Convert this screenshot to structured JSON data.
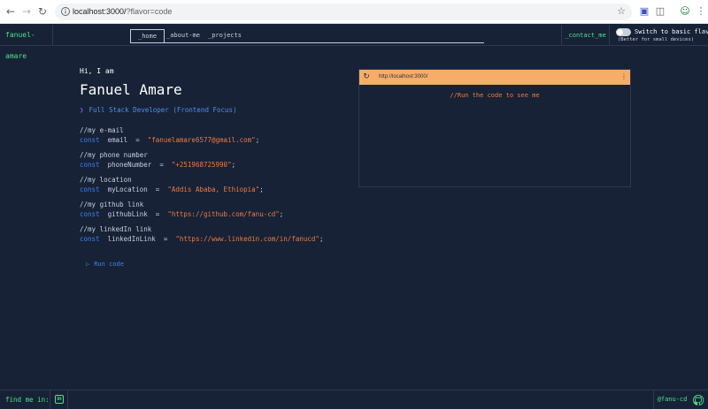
{
  "browser": {
    "url_host": "localhost:3000/",
    "url_path": "?flavor=code"
  },
  "header": {
    "logo": "fanuel-amare",
    "tabs": [
      {
        "label": "_home",
        "active": true
      },
      {
        "label": "_about-me",
        "active": false
      },
      {
        "label": "_projects",
        "active": false
      }
    ],
    "contact": "_contact_me",
    "flavor_toggle_label": "Switch to basic flavor",
    "flavor_toggle_hint": "(Better for small devices)"
  },
  "intro": {
    "greeting": "Hi, I am",
    "name": "Fanuel Amare",
    "role": "Full Stack Developer (Frontend Focus)"
  },
  "code": [
    {
      "comment": "//my e-mail",
      "keyword": "const",
      "var": "email",
      "op": "=",
      "value": "\"fanuelamare6577@gmail.com\"",
      "end": ";"
    },
    {
      "comment": "//my phone number",
      "keyword": "const",
      "var": "phoneNumber",
      "op": "=",
      "value": "\"+251968725990\"",
      "end": ";"
    },
    {
      "comment": "//my location",
      "keyword": "const",
      "var": "myLocation",
      "op": "=",
      "value": "\"Addis Ababa, Ethiopia\"",
      "end": ";"
    },
    {
      "comment": "//my github link",
      "keyword": "const",
      "var": "githubLink",
      "op": "=",
      "value": "\"https://github.com/fanu-cd\"",
      "end": ";"
    },
    {
      "comment": "//my linkedIn link",
      "keyword": "const",
      "var": "linkedInLink",
      "op": "=",
      "value": "\"https://www.linkedin.com/in/fanucd\"",
      "end": ";"
    }
  ],
  "run_label": "Run code",
  "preview": {
    "url": "http://localhost:3000/",
    "message": "//Run the code to see me"
  },
  "footer": {
    "find_me": "find me in:",
    "handle": "@fanu-cd"
  },
  "colors": {
    "background": "#172236",
    "accent_green": "#4de38a",
    "keyword_blue": "#3b82f6",
    "string_orange": "#f07a3c",
    "preview_bar": "#f7ad6a"
  }
}
